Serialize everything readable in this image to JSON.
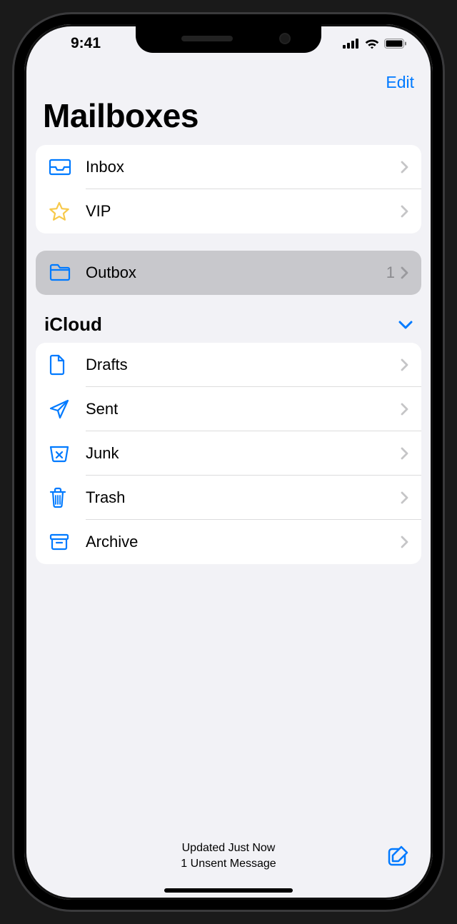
{
  "statusbar": {
    "time": "9:41"
  },
  "navbar": {
    "edit": "Edit"
  },
  "page_title": "Mailboxes",
  "top_group": [
    {
      "icon": "inbox-icon",
      "label": "Inbox"
    },
    {
      "icon": "star-icon",
      "label": "VIP"
    }
  ],
  "outbox_group": [
    {
      "icon": "folder-icon",
      "label": "Outbox",
      "count": "1"
    }
  ],
  "account": {
    "name": "iCloud"
  },
  "icloud_group": [
    {
      "icon": "document-icon",
      "label": "Drafts"
    },
    {
      "icon": "paperplane-icon",
      "label": "Sent"
    },
    {
      "icon": "junk-icon",
      "label": "Junk"
    },
    {
      "icon": "trash-icon",
      "label": "Trash"
    },
    {
      "icon": "archive-icon",
      "label": "Archive"
    }
  ],
  "toolbar": {
    "status_line1": "Updated Just Now",
    "status_line2": "1 Unsent Message"
  },
  "colors": {
    "accent": "#007aff",
    "star": "#f7c94b",
    "chevron": "#c5c5c7",
    "bg": "#f2f2f6"
  }
}
